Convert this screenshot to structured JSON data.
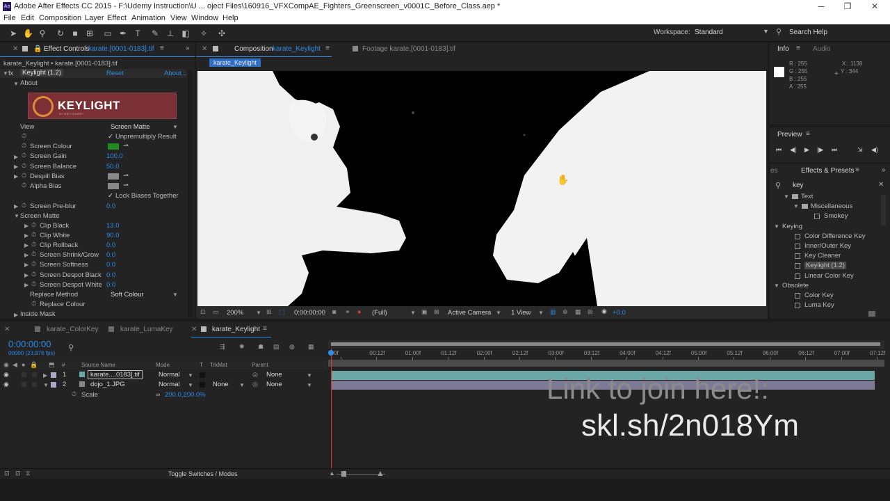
{
  "title_bar": {
    "title": "Adobe After Effects CC 2015 - F:\\Udemy Instruction\\U ... oject Files\\160916_VFXCompAE_Fighters_Greenscreen_v0001C_Before_Class.aep *"
  },
  "menu": [
    "File",
    "Edit",
    "Composition",
    "Layer",
    "Effect",
    "Animation",
    "View",
    "Window",
    "Help"
  ],
  "toolbar": {
    "workspace_label": "Workspace:",
    "workspace_value": "Standard",
    "search_help": "Search Help"
  },
  "effect_controls": {
    "tab_label": "Effect Controls",
    "tab_file": "karate.[0001-0183].tif",
    "breadcrumb": "karate_Keylight • karate.[0001-0183].tif",
    "effect_name": "Keylight (1.2)",
    "reset": "Reset",
    "about_link": "About...",
    "about_group": "About",
    "logo_text": "KEYLIGHT",
    "logo_sub": "BY THE FOUNDRY",
    "view_label": "View",
    "view_value": "Screen Matte",
    "unpremultiply": "Unpremultiply Result",
    "screen_colour": "Screen Colour",
    "screen_gain": "Screen Gain",
    "screen_gain_val": "100.0",
    "screen_balance": "Screen Balance",
    "screen_balance_val": "50.0",
    "despill_bias": "Despill Bias",
    "alpha_bias": "Alpha Bias",
    "lock_biases": "Lock Biases Together",
    "screen_prebur": "Screen Pre-blur",
    "screen_prebur_val": "0.0",
    "screen_matte": "Screen Matte",
    "clip_black": "Clip Black",
    "clip_black_val": "13.0",
    "clip_white": "Clip White",
    "clip_white_val": "90.0",
    "clip_rollback": "Clip Rollback",
    "clip_rollback_val": "0.0",
    "shrink_grow": "Screen Shrink/Grow",
    "shrink_grow_val": "0.0",
    "softness": "Screen Softness",
    "softness_val": "0.0",
    "despot_black": "Screen Despot Black",
    "despot_black_val": "0.0",
    "despot_white": "Screen Despot White",
    "despot_white_val": "0.0",
    "replace_method": "Replace Method",
    "replace_method_val": "Soft Colour",
    "replace_colour": "Replace Colour",
    "inside_mask": "Inside Mask"
  },
  "composition": {
    "tab_label": "Composition",
    "tab_name": "karate_Keylight",
    "footage_tab": "Footage karate.[0001-0183].tif",
    "sub_tab": "karate_Keylight",
    "zoom": "200%",
    "timecode": "0:00:00:00",
    "resolution": "(Full)",
    "camera": "Active Camera",
    "views": "1 View",
    "exposure": "+0.0"
  },
  "info": {
    "tab": "Info",
    "audio_tab": "Audio",
    "r": "R : 255",
    "g": "G : 255",
    "b": "B : 255",
    "a": "A : 255",
    "x": "X : 1138",
    "y": "Y : 344"
  },
  "preview": {
    "tab": "Preview"
  },
  "effects_presets": {
    "left_tab": "es",
    "tab": "Effects & Presets",
    "search": "key",
    "items": [
      {
        "label": "Text",
        "indent": 1,
        "kind": "folder",
        "open": true
      },
      {
        "label": "Miscellaneous",
        "indent": 2,
        "kind": "folder",
        "open": true
      },
      {
        "label": "Smokey",
        "indent": 3,
        "kind": "fx"
      },
      {
        "label": "Keying",
        "indent": 0,
        "kind": "group",
        "open": true
      },
      {
        "label": "Color Difference Key",
        "indent": 1,
        "kind": "fx"
      },
      {
        "label": "Inner/Outer Key",
        "indent": 1,
        "kind": "fx"
      },
      {
        "label": "Key Cleaner",
        "indent": 1,
        "kind": "fx"
      },
      {
        "label": "Keylight (1.2)",
        "indent": 1,
        "kind": "fx",
        "selected": true
      },
      {
        "label": "Linear Color Key",
        "indent": 1,
        "kind": "fx"
      },
      {
        "label": "Obsolete",
        "indent": 0,
        "kind": "group",
        "open": true
      },
      {
        "label": "Color Key",
        "indent": 1,
        "kind": "fx"
      },
      {
        "label": "Luma Key",
        "indent": 1,
        "kind": "fx"
      }
    ]
  },
  "timeline": {
    "tabs": [
      "karate_ColorKey",
      "karate_LumaKey",
      "karate_Keylight"
    ],
    "timecode": "0:00:00:00",
    "fps": "00000 (23.976 fps)",
    "columns": {
      "num": "#",
      "source": "Source Name",
      "mode": "Mode",
      "t": "T",
      "trkmat": "TrkMat",
      "parent": "Parent"
    },
    "layers": [
      {
        "num": "1",
        "name": "karate....0183].tif",
        "mode": "Normal",
        "trkmat": "",
        "parent": "None"
      },
      {
        "num": "2",
        "name": "dojo_1.JPG",
        "mode": "Normal",
        "trkmat": "None",
        "parent": "None"
      }
    ],
    "scale_label": "Scale",
    "scale_value": "200.0,200.0%",
    "ruler": [
      "0f",
      "00:12f",
      "01:00f",
      "01:12f",
      "02:00f",
      "02:12f",
      "03:00f",
      "03:12f",
      "04:00f",
      "04:12f",
      "05:00f",
      "05:12f",
      "06:00f",
      "06:12f",
      "07:00f",
      "07:12f"
    ],
    "toggle": "Toggle Switches / Modes"
  },
  "overlay": {
    "line1": "Link to join here!:",
    "line2": "skl.sh/2n018Ym"
  }
}
